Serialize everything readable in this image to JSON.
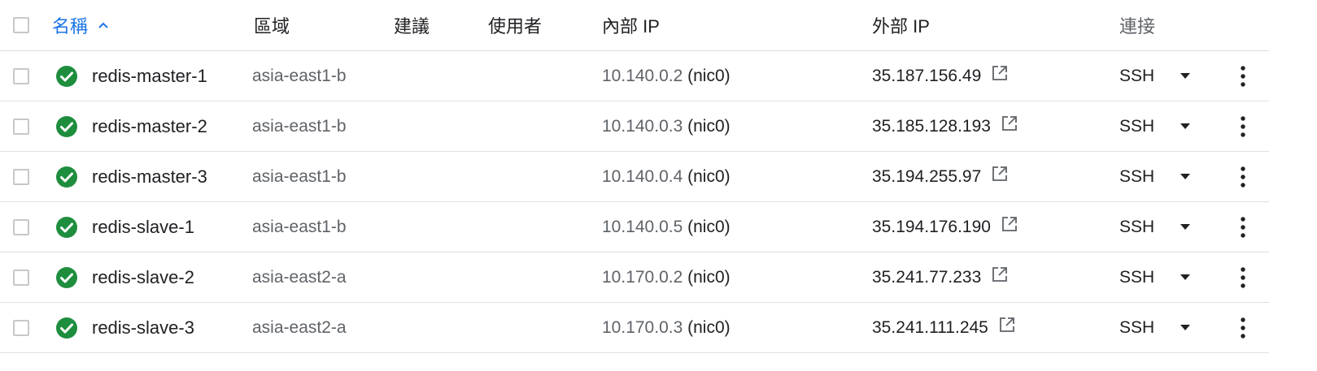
{
  "header": {
    "name": "名稱",
    "zone": "區域",
    "recommendation": "建議",
    "in_use_by": "使用者",
    "internal_ip": "內部 IP",
    "external_ip": "外部 IP",
    "connect": "連接"
  },
  "colors": {
    "accent": "#1a73e8",
    "status_ok": "#1e8e3e",
    "text": "#202124",
    "muted": "#5f6368"
  },
  "rows": [
    {
      "name": "redis-master-1",
      "zone": "asia-east1-b",
      "internal_ip": "10.140.0.2",
      "nic": "(nic0)",
      "external_ip": "35.187.156.49",
      "connect": "SSH"
    },
    {
      "name": "redis-master-2",
      "zone": "asia-east1-b",
      "internal_ip": "10.140.0.3",
      "nic": "(nic0)",
      "external_ip": "35.185.128.193",
      "connect": "SSH"
    },
    {
      "name": "redis-master-3",
      "zone": "asia-east1-b",
      "internal_ip": "10.140.0.4",
      "nic": "(nic0)",
      "external_ip": "35.194.255.97",
      "connect": "SSH"
    },
    {
      "name": "redis-slave-1",
      "zone": "asia-east1-b",
      "internal_ip": "10.140.0.5",
      "nic": "(nic0)",
      "external_ip": "35.194.176.190",
      "connect": "SSH"
    },
    {
      "name": "redis-slave-2",
      "zone": "asia-east2-a",
      "internal_ip": "10.170.0.2",
      "nic": "(nic0)",
      "external_ip": "35.241.77.233",
      "connect": "SSH"
    },
    {
      "name": "redis-slave-3",
      "zone": "asia-east2-a",
      "internal_ip": "10.170.0.3",
      "nic": "(nic0)",
      "external_ip": "35.241.111.245",
      "connect": "SSH"
    }
  ]
}
